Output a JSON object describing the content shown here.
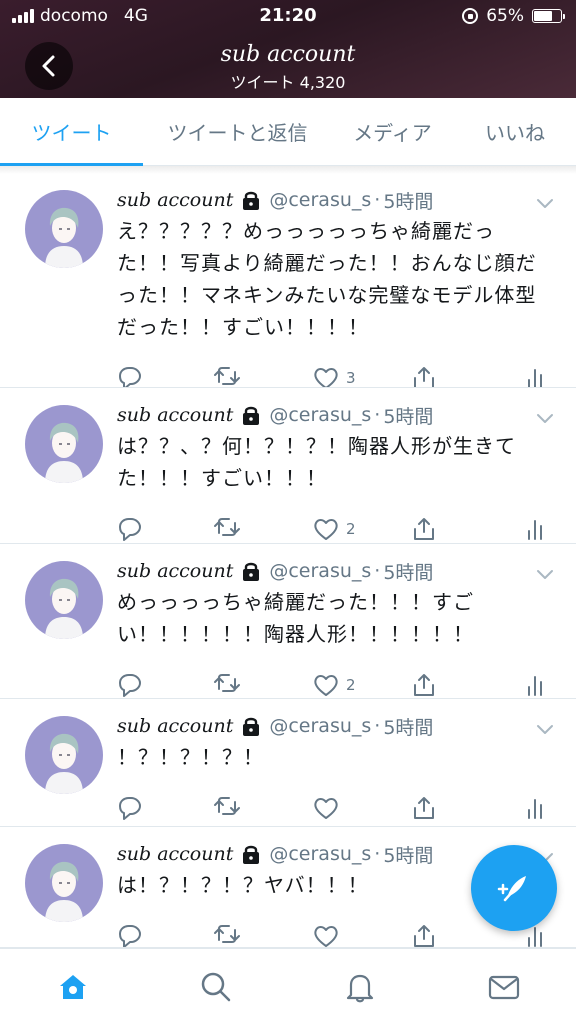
{
  "status_bar": {
    "carrier": "docomo",
    "network": "4G",
    "time": "21:20",
    "battery_percent_label": "65%",
    "battery_level": 0.65
  },
  "header": {
    "title": "sub account",
    "subtitle": "ツイート 4,320"
  },
  "tabs": [
    {
      "label": "ツイート",
      "active": true
    },
    {
      "label": "ツイートと返信",
      "active": false
    },
    {
      "label": "メディア",
      "active": false
    },
    {
      "label": "いいね",
      "active": false
    }
  ],
  "tweets": [
    {
      "name": "sub account",
      "handle": "@cerasu_s",
      "dot": "·",
      "time": "5時間",
      "lines": [
        "え？？？？？めっっっっっちゃ綺麗だっ",
        "た！！写真より綺麗だった！！おんなじ顔だ",
        "った！！マネキンみたいな完璧なモデル体型",
        "だった！！すごい！！！！"
      ],
      "likes": "3"
    },
    {
      "name": "sub account",
      "handle": "@cerasu_s",
      "dot": "·",
      "time": "5時間",
      "lines": [
        "は？？、？何！？！？！陶器人形が生きて",
        "た！！！すごい！！！"
      ],
      "likes": "2"
    },
    {
      "name": "sub account",
      "handle": "@cerasu_s",
      "dot": "·",
      "time": "5時間",
      "lines": [
        "めっっっっちゃ綺麗だった！！！すご",
        "い！！！！！！陶器人形！！！！！！"
      ],
      "likes": "2"
    },
    {
      "name": "sub account",
      "handle": "@cerasu_s",
      "dot": "·",
      "time": "5時間",
      "lines": [
        "！？！？！？！"
      ],
      "likes": ""
    },
    {
      "name": "sub account",
      "handle": "@cerasu_s",
      "dot": "·",
      "time": "5時間",
      "lines": [
        "は！？！？！？ヤバ！！！"
      ],
      "likes": ""
    }
  ],
  "icons": {
    "back": "chevron-left-icon",
    "lock": "lock-icon",
    "caret": "chevron-down-icon",
    "reply": "reply-icon",
    "retweet": "retweet-icon",
    "like": "heart-icon",
    "share": "share-icon",
    "analytics": "analytics-icon",
    "compose": "compose-feather-icon",
    "home": "home-icon",
    "search": "search-icon",
    "notifications": "bell-icon",
    "messages": "envelope-icon"
  },
  "colors": {
    "accent": "#1da1f2",
    "text": "#14171a",
    "secondary": "#657786",
    "avatar_bg": "#9b97cf"
  }
}
